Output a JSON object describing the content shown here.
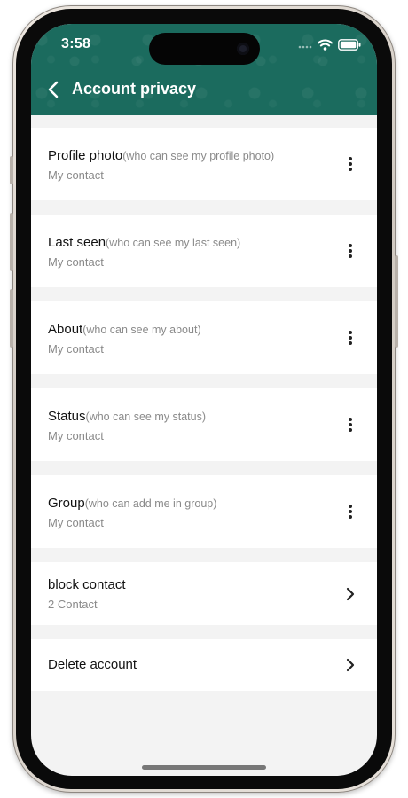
{
  "status_bar": {
    "time": "3:58"
  },
  "header": {
    "title": "Account privacy",
    "color": "#1b6b5e"
  },
  "privacy_items": [
    {
      "label": "Profile photo",
      "hint": "(who can see my profile photo)",
      "value": "My contact",
      "action_icon": "more-vertical-icon"
    },
    {
      "label": "Last seen",
      "hint": "(who can see my last seen)",
      "value": "My contact",
      "action_icon": "more-vertical-icon"
    },
    {
      "label": "About",
      "hint": "(who can see my about)",
      "value": "My contact",
      "action_icon": "more-vertical-icon"
    },
    {
      "label": "Status",
      "hint": "(who can see my status)",
      "value": "My contact",
      "action_icon": "more-vertical-icon"
    },
    {
      "label": "Group",
      "hint": "(who can add me in group)",
      "value": "My contact",
      "action_icon": "more-vertical-icon"
    }
  ],
  "block_contact": {
    "label": "block contact",
    "value": "2 Contact",
    "action_icon": "chevron-right-icon"
  },
  "delete_account": {
    "label": "Delete account",
    "action_icon": "chevron-right-icon"
  }
}
